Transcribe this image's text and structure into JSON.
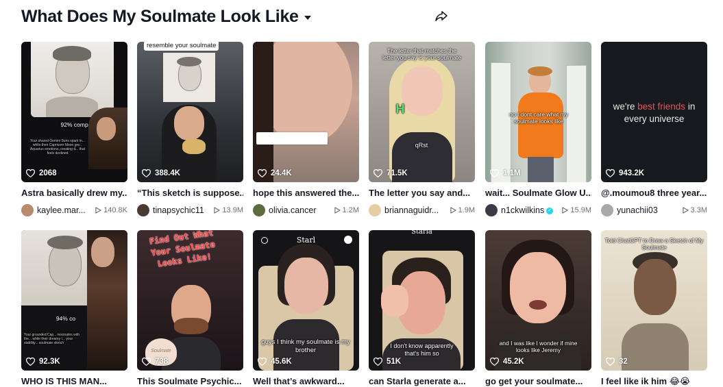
{
  "header": {
    "title": "What Does My Soulmate Look Like"
  },
  "videos": [
    {
      "likes": "2068",
      "caption": "Astra basically drew my...",
      "user": "kaylee.mar...",
      "views": "140.8K",
      "overlay": "92% compa",
      "overlay2": "Your shared Gemini Suns spark in... while their Capricorn Moon gro... Aquarius emotions, creating d... that feels destined"
    },
    {
      "likes": "388.4K",
      "caption": "“This sketch is suppose...",
      "user": "tinapsychic11",
      "views": "13.9M",
      "overlay": "resemble your soulmate"
    },
    {
      "likes": "24.4K",
      "caption": "hope this answered the...",
      "user": "olivia.cancer",
      "views": "1.2M"
    },
    {
      "likes": "71.5K",
      "caption": "The letter you say and...",
      "user": "briannaguidr...",
      "views": "1.9M",
      "overlay": "The letter that matches the letter you say is your soulmate",
      "letter": "H",
      "overlay2": "qRst"
    },
    {
      "likes": "1.1M",
      "caption": "wait... Soulmate Glow U...",
      "user": "n1ckwilkins",
      "views": "15.9M",
      "overlay": "no I dont care what my soulmate looks like"
    },
    {
      "likes": "943.2K",
      "caption": "@.moumou8 three year...",
      "user": "yunachii03",
      "views": "3.3M",
      "overlay_a": "we're ",
      "overlay_b": "best friends",
      "overlay_c": " in every universe"
    },
    {
      "likes": "92.3K",
      "caption": "WHO IS THIS MAN...",
      "overlay": "94% co",
      "overlay2": "Your grounded Cap... resonates with the... while their dreamy I... your stability... soulmate sketch"
    },
    {
      "likes": "738",
      "caption": "This Soulmate Psychic...",
      "overlay": "Find Out What Your Soulmate Looks Like!",
      "overlay2": "Soulmate"
    },
    {
      "likes": "45.6K",
      "caption": "Well that’s awkward...",
      "overlay": "guys I think my soulmate is my brother",
      "overlay2": "Starl"
    },
    {
      "likes": "51K",
      "caption": "can Starla generate a...",
      "overlay": "I don't know apparently that's him so",
      "overlay2": "Starla"
    },
    {
      "likes": "45.2K",
      "caption": "go get your soulmate...",
      "overlay": "and I was like I wonder if mine looks like Jeremy"
    },
    {
      "likes": "32",
      "caption": "I feel like ik him 😂😭",
      "overlay": "Told ChatGPT to Draw a Sketch of My Soulmate"
    }
  ],
  "colors": {
    "accent": "#fe2c55",
    "verified": "#20d5ec"
  }
}
